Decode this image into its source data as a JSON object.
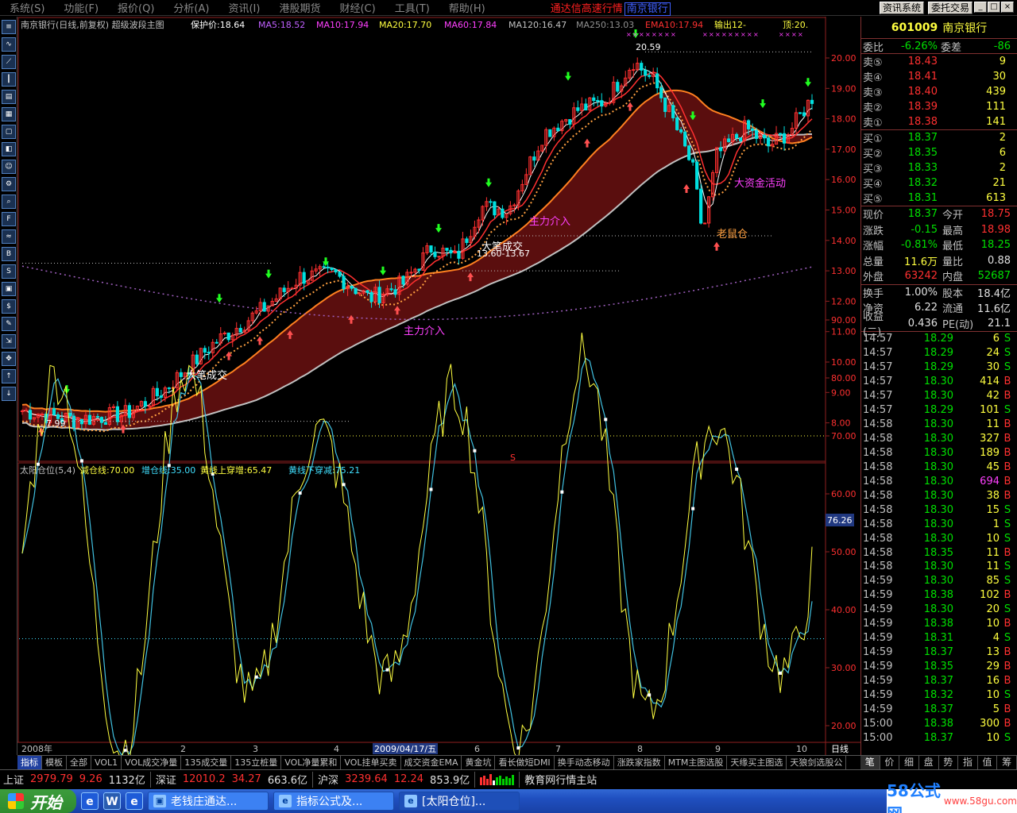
{
  "menu": [
    "系统(S)",
    "功能(F)",
    "报价(Q)",
    "分析(A)",
    "资讯(I)",
    "港股期货",
    "财经(C)",
    "工具(T)",
    "帮助(H)"
  ],
  "window_title": "通达信高速行情",
  "window_title_inner": "南京银行",
  "top_buttons": {
    "news": "资讯系统",
    "trade": "委托交易"
  },
  "chart_header": {
    "name": "南京银行(日线,前复权) 超级波段主图",
    "protect": "保护价:18.64",
    "ma5": "MA5:18.52",
    "ma10": "MA10:17.94",
    "ma20": "MA20:17.70",
    "ma60": "MA60:17.84",
    "ma120": "MA120:16.47",
    "ma250": "MA250:13.03",
    "ema10": "EMA10:17.94",
    "output": "输出12-",
    "top": "顶:20."
  },
  "price_axis": [
    "20.00",
    "19.00",
    "18.00",
    "17.00",
    "16.00",
    "15.00",
    "14.00",
    "13.00",
    "12.00",
    "11.00",
    "10.00",
    "9.00",
    "8.00"
  ],
  "annotations": {
    "high": "20.59",
    "low": "7.99",
    "mid_low": "13.60-13.67",
    "big_deal_1": "大笔成交",
    "big_deal_2": "大笔成交",
    "main_force_1": "主力介入",
    "main_force_2": "主力介入",
    "fund_active": "大资金活动",
    "rat_store": "老鼠仓",
    "s_mark": "S"
  },
  "indicator_header": {
    "name": "太阳仓位(5,4)",
    "reduce": "减仓线:70.00",
    "add": "增仓线:35.00",
    "up_cross": "黄线上穿增:65.47",
    "down_cross": "黄线下穿减:75.21",
    "current": "76.26"
  },
  "indicator_axis": [
    "90.00",
    "80.00",
    "70.00",
    "60.00",
    "50.00",
    "40.00",
    "30.00",
    "20.00"
  ],
  "date_axis": {
    "start": "2008年",
    "ticks": [
      "1",
      "2",
      "3",
      "4",
      "5",
      "6",
      "7",
      "8",
      "9",
      "10"
    ],
    "cursor_date": "2009/04/17/五",
    "period": "日线"
  },
  "stock": {
    "code": "601009",
    "name": "南京银行"
  },
  "order_ratio": {
    "label": "委比",
    "value": "-6.26%",
    "label2": "委差",
    "value2": "-86"
  },
  "asks": [
    {
      "label": "卖⑤",
      "price": "18.43",
      "vol": "9"
    },
    {
      "label": "卖④",
      "price": "18.41",
      "vol": "30"
    },
    {
      "label": "卖③",
      "price": "18.40",
      "vol": "439"
    },
    {
      "label": "卖②",
      "price": "18.39",
      "vol": "111"
    },
    {
      "label": "卖①",
      "price": "18.38",
      "vol": "141"
    }
  ],
  "bids": [
    {
      "label": "买①",
      "price": "18.37",
      "vol": "2"
    },
    {
      "label": "买②",
      "price": "18.35",
      "vol": "6"
    },
    {
      "label": "买③",
      "price": "18.33",
      "vol": "2"
    },
    {
      "label": "买④",
      "price": "18.32",
      "vol": "21"
    },
    {
      "label": "买⑤",
      "price": "18.31",
      "vol": "613"
    }
  ],
  "quote": [
    {
      "l1": "现价",
      "v1": "18.37",
      "c1": "green",
      "l2": "今开",
      "v2": "18.75",
      "c2": "red"
    },
    {
      "l1": "涨跌",
      "v1": "-0.15",
      "c1": "green",
      "l2": "最高",
      "v2": "18.98",
      "c2": "red"
    },
    {
      "l1": "涨幅",
      "v1": "-0.81%",
      "c1": "green",
      "l2": "最低",
      "v2": "18.25",
      "c2": "green"
    },
    {
      "l1": "总量",
      "v1": "11.6万",
      "c1": "yellow",
      "l2": "量比",
      "v2": "0.88",
      "c2": "white"
    },
    {
      "l1": "外盘",
      "v1": "63242",
      "c1": "red",
      "l2": "内盘",
      "v2": "52687",
      "c2": "green"
    }
  ],
  "fundamentals": [
    {
      "l1": "换手",
      "v1": "1.00%",
      "l2": "股本",
      "v2": "18.4亿"
    },
    {
      "l1": "净资",
      "v1": "6.22",
      "l2": "流通",
      "v2": "11.6亿"
    },
    {
      "l1": "收益(二)",
      "v1": "0.436",
      "l2": "PE(动)",
      "v2": "21.1"
    }
  ],
  "ticks": [
    {
      "t": "14:57",
      "p": "18.29",
      "v": "6",
      "d": "S"
    },
    {
      "t": "14:57",
      "p": "18.29",
      "v": "24",
      "d": "S"
    },
    {
      "t": "14:57",
      "p": "18.29",
      "v": "30",
      "d": "S"
    },
    {
      "t": "14:57",
      "p": "18.30",
      "v": "414",
      "d": "B"
    },
    {
      "t": "14:57",
      "p": "18.30",
      "v": "42",
      "d": "B"
    },
    {
      "t": "14:57",
      "p": "18.29",
      "v": "101",
      "d": "S"
    },
    {
      "t": "14:58",
      "p": "18.30",
      "v": "11",
      "d": "B"
    },
    {
      "t": "14:58",
      "p": "18.30",
      "v": "327",
      "d": "B"
    },
    {
      "t": "14:58",
      "p": "18.30",
      "v": "189",
      "d": "B"
    },
    {
      "t": "14:58",
      "p": "18.30",
      "v": "45",
      "d": "B"
    },
    {
      "t": "14:58",
      "p": "18.30",
      "v": "694",
      "d": "B"
    },
    {
      "t": "14:58",
      "p": "18.30",
      "v": "38",
      "d": "B"
    },
    {
      "t": "14:58",
      "p": "18.30",
      "v": "15",
      "d": "S"
    },
    {
      "t": "14:58",
      "p": "18.30",
      "v": "1",
      "d": "S"
    },
    {
      "t": "14:58",
      "p": "18.30",
      "v": "10",
      "d": "S"
    },
    {
      "t": "14:58",
      "p": "18.35",
      "v": "11",
      "d": "B"
    },
    {
      "t": "14:58",
      "p": "18.30",
      "v": "11",
      "d": "S"
    },
    {
      "t": "14:59",
      "p": "18.30",
      "v": "85",
      "d": "S"
    },
    {
      "t": "14:59",
      "p": "18.38",
      "v": "102",
      "d": "B"
    },
    {
      "t": "14:59",
      "p": "18.30",
      "v": "20",
      "d": "S"
    },
    {
      "t": "14:59",
      "p": "18.38",
      "v": "10",
      "d": "B"
    },
    {
      "t": "14:59",
      "p": "18.31",
      "v": "4",
      "d": "S"
    },
    {
      "t": "14:59",
      "p": "18.37",
      "v": "13",
      "d": "B"
    },
    {
      "t": "14:59",
      "p": "18.35",
      "v": "29",
      "d": "B"
    },
    {
      "t": "14:59",
      "p": "18.37",
      "v": "16",
      "d": "B"
    },
    {
      "t": "14:59",
      "p": "18.32",
      "v": "10",
      "d": "S"
    },
    {
      "t": "14:59",
      "p": "18.37",
      "v": "5",
      "d": "B"
    },
    {
      "t": "15:00",
      "p": "18.38",
      "v": "300",
      "d": "B"
    },
    {
      "t": "15:00",
      "p": "18.37",
      "v": "10",
      "d": "S"
    }
  ],
  "indicator_tabs": [
    "指标",
    "模板",
    "全部",
    "VOL1",
    "VOL成交净量",
    "135成交量",
    "135立桩量",
    "VOL净量累和",
    "VOL挂单买卖",
    "成交资金EMA",
    "黄金坑",
    "看长做短DMI",
    "换手动态移动",
    "涨跌家指数",
    "MTM主图选股",
    "天缘买主图选",
    "天狼剑选股公"
  ],
  "panel_tabs": [
    "笔",
    "价",
    "细",
    "盘",
    "势",
    "指",
    "值",
    "筹"
  ],
  "status": {
    "sh_label": "上证",
    "sh_index": "2979.79",
    "sh_chg": "9.26",
    "sh_amt": "1132亿",
    "sz_label": "深证",
    "sz_index": "12010.2",
    "sz_chg": "34.27",
    "sz_amt": "663.6亿",
    "hs_label": "沪深",
    "hs_index": "3239.64",
    "hs_chg": "12.24",
    "hs_amt": "853.9亿",
    "site": "教育网行情主站"
  },
  "taskbar": {
    "start": "开始",
    "tasks": [
      "老钱庄通达...",
      "指标公式及...",
      "[太阳仓位]..."
    ],
    "watermark": "58公式网",
    "watermark_url": "www.58gu.com"
  },
  "colors": {
    "up": "#ff3030",
    "down": "#00e0e0",
    "ma5": "#ffffff",
    "ma10": "#ff3030",
    "ma20": "#40ff40",
    "protect": "#ffa040",
    "ma250": "#c0c0c0",
    "fill": "#6a1010"
  }
}
